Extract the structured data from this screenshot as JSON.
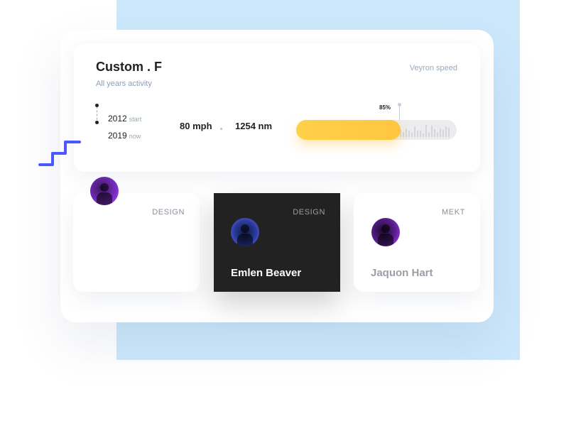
{
  "header": {
    "title": "Custom . F",
    "subtitle": "All years activity",
    "right_label": "Veyron speed"
  },
  "timeline": {
    "rows": [
      {
        "year": "2012",
        "tag": "start"
      },
      {
        "year": "2019",
        "tag": "now"
      }
    ]
  },
  "metrics": {
    "speed": "80 mph",
    "distance": "1254 nm"
  },
  "progress": {
    "label": "85%",
    "value": 0.65,
    "color": "#ffc63f"
  },
  "cards": [
    {
      "tag": "DESIGN",
      "name": ""
    },
    {
      "tag": "DESIGN",
      "name": "Emlen Beaver"
    },
    {
      "tag": "MEKT",
      "name": "Jaquon Hart"
    }
  ],
  "colors": {
    "background_panel": "#cde8fb",
    "dark_card": "#222222",
    "squiggle": "#4b57ff"
  }
}
